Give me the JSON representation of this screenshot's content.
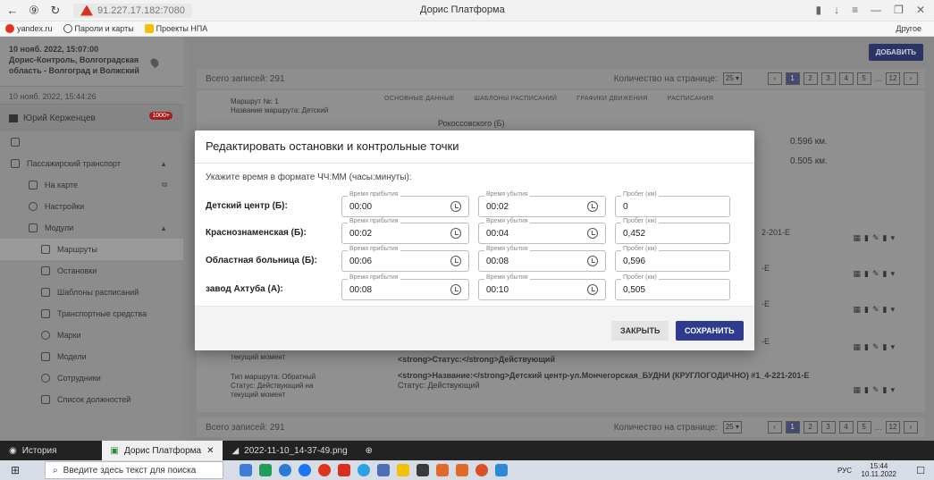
{
  "browser": {
    "url": "91.227.17.182:7080",
    "title": "Дорис Платформа",
    "bookmarks": [
      "yandex.ru",
      "Пароли и карты",
      "Проекты НПА"
    ],
    "other_bookmarks": "Другое"
  },
  "sidebar": {
    "header_time": "10 нояб. 2022, 15:07:00",
    "header_org": "Дорис-Контроль, Волгоградская область - Волгоград и Волжский",
    "time2": "10 нояб. 2022, 15:44:26",
    "user_name": "Юрий Керженцев",
    "badge": "1000+",
    "items": [
      {
        "label": "Пассажирский транспорт",
        "level": 0
      },
      {
        "label": "На карте",
        "level": 1
      },
      {
        "label": "Настройки",
        "level": 1
      },
      {
        "label": "Модули",
        "level": 1
      },
      {
        "label": "Маршруты",
        "level": 2
      },
      {
        "label": "Остановки",
        "level": 2
      },
      {
        "label": "Шаблоны расписаний",
        "level": 2
      },
      {
        "label": "Транспортные средства",
        "level": 2
      },
      {
        "label": "Марки",
        "level": 2
      },
      {
        "label": "Модели",
        "level": 2
      },
      {
        "label": "Сотрудники",
        "level": 2
      },
      {
        "label": "Список должностей",
        "level": 2
      }
    ]
  },
  "content": {
    "add_button": "ДОБАВИТЬ",
    "total_records": "Всего записей: 291",
    "per_page_label": "Количество на странице:",
    "per_page_value": "25",
    "pages": [
      "1",
      "2",
      "3",
      "4",
      "5",
      "...",
      "12"
    ],
    "tabs": [
      "ОСНОВНЫЕ ДАННЫЕ",
      "ШАБЛОНЫ РАСПИСАНИЙ",
      "ГРАФИКИ ДВИЖЕНИЯ",
      "РАСПИСАНИЯ"
    ],
    "route_no": "Маршрут №: 1",
    "route_name": "Название маршрута: Детский",
    "partial_top": "Рокоссовского (Б)",
    "km1": "0.596 км.",
    "km2": "0.505 км.",
    "row_code1": "2-201-Е",
    "status_text": "<strong>Статус:</strong>Действующий",
    "row_left_moment": "текущий момент",
    "row2_left": "Тип маршрута: Обратный",
    "row2_left_status": "Статус: Действующий на",
    "row2_left_moment": "текущий момент",
    "row2_right_name": "<strong>Название:</strong>Детский центр-ул.Мончегорская_БУДНИ (КРУГЛОГОДИЧНО) #1_4-221-201-Е",
    "row2_right_status": "Статус: Действующий",
    "e1": "-Е",
    "e2": "-Е",
    "e3": "-Е"
  },
  "modal": {
    "title": "Редактировать остановки и контрольные точки",
    "hint": "Укажите время в формате ЧЧ:ММ (часы:минуты):",
    "label_arrival": "Время прибытия",
    "label_departure": "Время убытия",
    "label_mileage": "Пробег (км)",
    "stops": [
      {
        "name": "Детский центр (Б):",
        "arrival": "00:00",
        "departure": "00:02",
        "mileage": "0"
      },
      {
        "name": "Краснознаменская (Б):",
        "arrival": "00:02",
        "departure": "00:04",
        "mileage": "0,452"
      },
      {
        "name": "Областная больница (Б):",
        "arrival": "00:06",
        "departure": "00:08",
        "mileage": "0,596"
      },
      {
        "name": "завод Ахтуба (А):",
        "arrival": "00:08",
        "departure": "00:10",
        "mileage": "0,505"
      }
    ],
    "close_button": "ЗАКРЫТЬ",
    "save_button": "СОХРАНИТЬ"
  },
  "bottom_tabs": {
    "history": "История",
    "active_tab": "Дорис Платформа",
    "file_tab": "2022-11-10_14-37-49.png"
  },
  "taskbar": {
    "search_placeholder": "Введите здесь текст для поиска",
    "lang": "РУС",
    "time": "15:44",
    "date": "10.11.2022"
  }
}
